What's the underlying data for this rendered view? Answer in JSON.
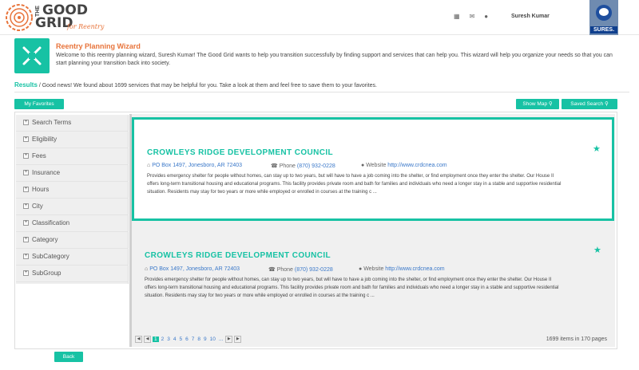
{
  "brand": {
    "the": "THE",
    "good": "GOOD",
    "grid": "GRID",
    "reentry": "for Reentry"
  },
  "header": {
    "user_name": "Suresh Kumar",
    "avatar_tag": "SURES."
  },
  "wizard": {
    "title": "Reentry Planning Wizard",
    "text": "Welcome to this reentry planning wizard, Suresh Kumar! The Good Grid wants to help you transition successfully by finding support and services that can help you. This wizard will help you organize your needs so that you can start planning your transition back into society."
  },
  "results": {
    "label": "Results",
    "text": " / Good news! We found about 1699 services that may be helpful for you. Take a look at them and feel free to save them to your favorites."
  },
  "buttons": {
    "favorites": "My Favorites",
    "show_map": "Show Map",
    "saved_search": "Saved Search",
    "back": "Back"
  },
  "filters": [
    "Search Terms",
    "Eligibility",
    "Fees",
    "Insurance",
    "Hours",
    "City",
    "Classification",
    "Category",
    "SubCategory",
    "SubGroup"
  ],
  "cards": [
    {
      "title": "CROWLEYS RIDGE DEVELOPMENT COUNCIL",
      "address": "PO Box 1497,  Jonesboro,  AR  72403",
      "phone_label": "Phone ",
      "phone": "(870) 932-0228",
      "website_label": "Website ",
      "website": "http://www.crdcnea.com",
      "description": "Provides emergency shelter for people without homes, can stay up to two years, but will have to have a job coming into the shelter, or find employment once they enter the shelter. Our House II offers long-term transitional housing and educational programs. This facility provides private room and bath for families and individuals who need a longer stay in a stable and supportive residential situation. Residents may stay for two years or more while employed or enrolled in courses at the training c ..."
    },
    {
      "title": "CROWLEYS RIDGE DEVELOPMENT COUNCIL",
      "address": "PO Box 1497,  Jonesboro,  AR  72403",
      "phone_label": "Phone ",
      "phone": "(870) 932-0228",
      "website_label": "Website ",
      "website": "http://www.crdcnea.com",
      "description": "Provides emergency shelter for people without homes, can stay up to two years, but will have to have a job coming into the shelter, or find employment once they enter the shelter. Our House II offers long-term transitional housing and educational programs. This facility provides private room and bath for families and individuals who need a longer stay in a stable and supportive residential situation. Residents may stay for two years or more while employed or enrolled in courses at the training c ..."
    }
  ],
  "pager": {
    "pages": [
      "1",
      "2",
      "3",
      "4",
      "5",
      "6",
      "7",
      "8",
      "9",
      "10",
      "..."
    ],
    "active": "1",
    "info": "1699 items in 170 pages"
  },
  "colors": {
    "accent": "#17c2a4",
    "brand_orange": "#e8743b",
    "link": "#3a78c9"
  }
}
